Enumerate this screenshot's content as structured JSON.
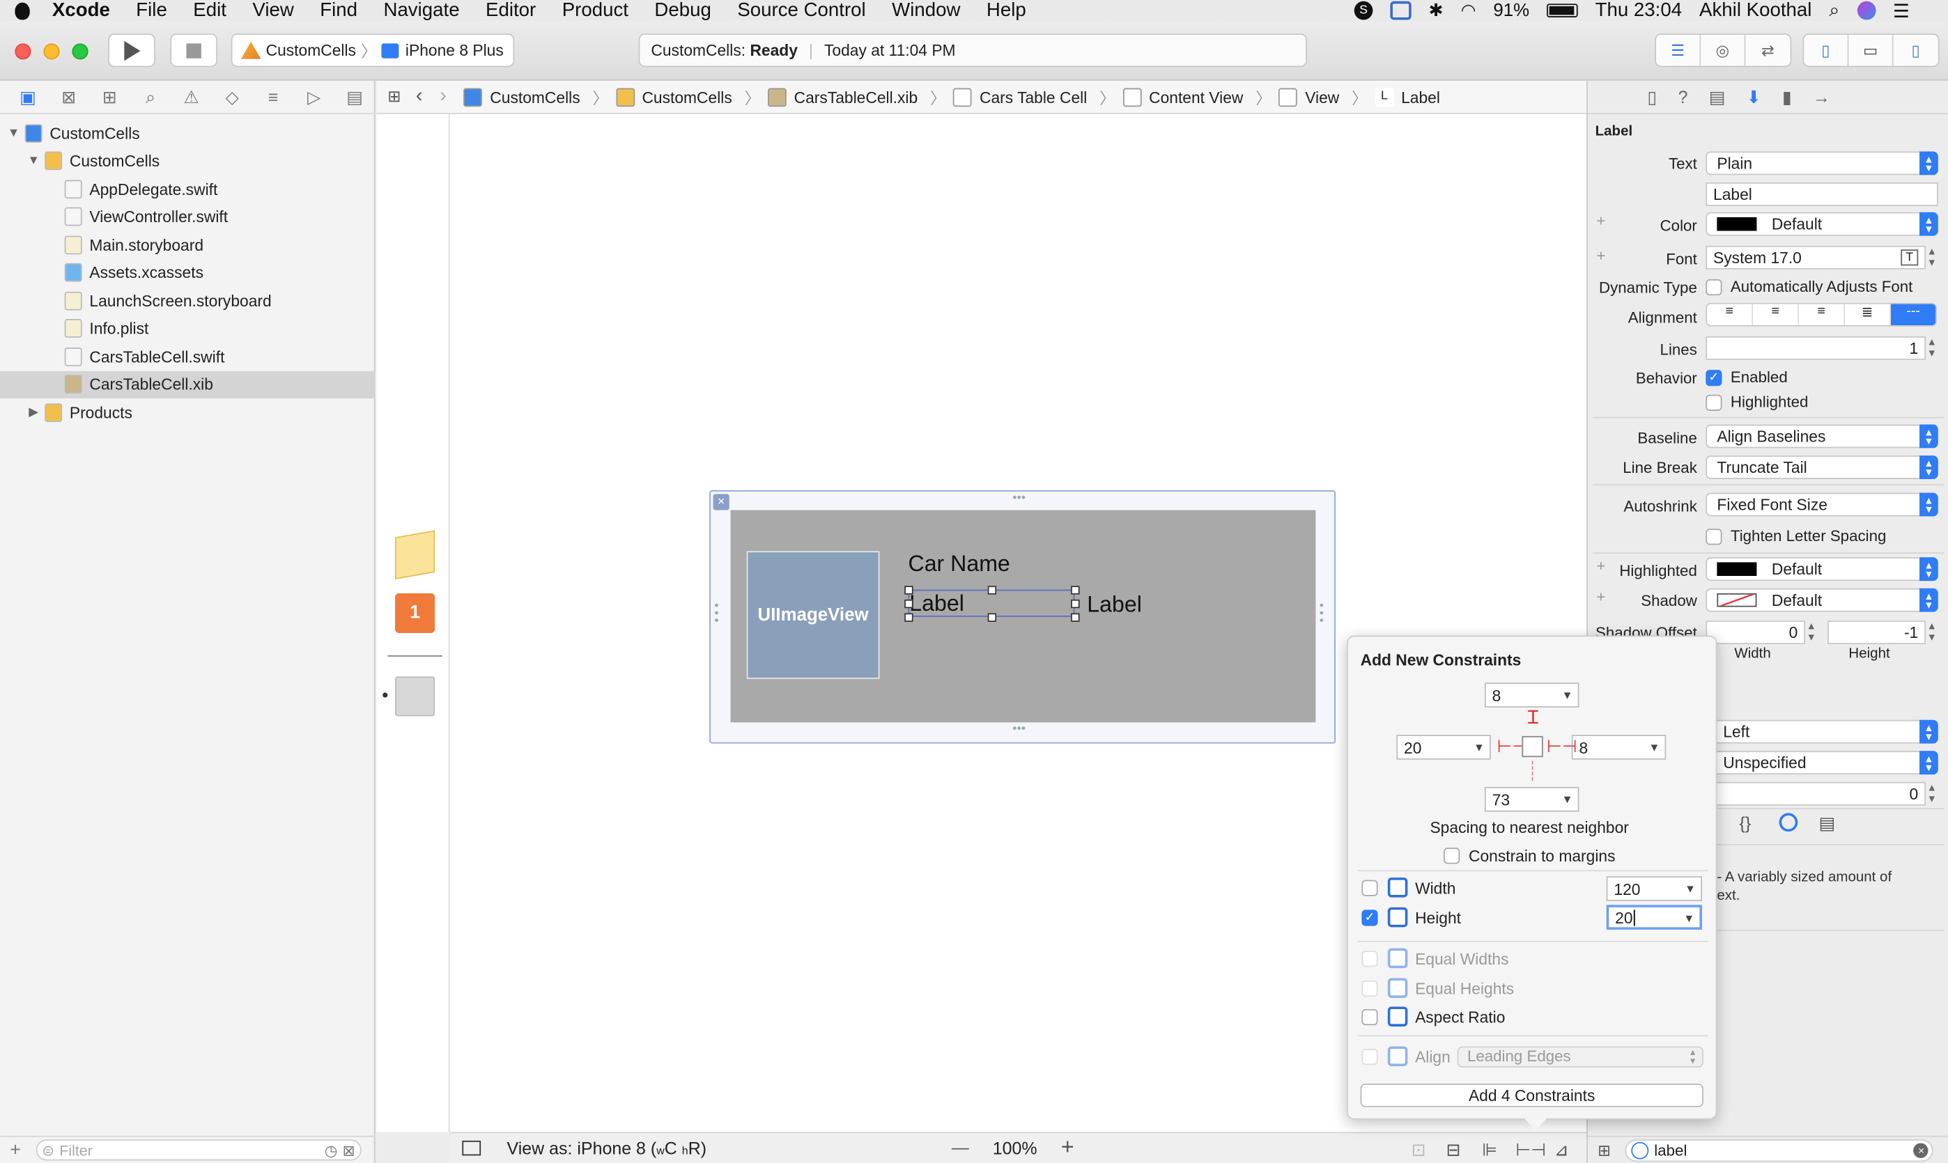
{
  "menubar": {
    "apple": "",
    "app": "Xcode",
    "items": [
      "File",
      "Edit",
      "View",
      "Find",
      "Navigate",
      "Editor",
      "Product",
      "Debug",
      "Source Control",
      "Window",
      "Help"
    ],
    "battery": "91%",
    "clock": "Thu 23:04",
    "user": "Akhil Koothal"
  },
  "toolbar": {
    "scheme": "CustomCells",
    "device": "iPhone 8 Plus",
    "status_project": "CustomCells:",
    "status_state": "Ready",
    "status_time": "Today at 11:04 PM"
  },
  "navigator": {
    "items": [
      {
        "label": "CustomCells",
        "indent": 0,
        "disc": "▼",
        "icon": "project-icon"
      },
      {
        "label": "CustomCells",
        "indent": 1,
        "disc": "▼",
        "icon": "folder-icon"
      },
      {
        "label": "AppDelegate.swift",
        "indent": 2,
        "disc": "",
        "icon": "swift-file-icon"
      },
      {
        "label": "ViewController.swift",
        "indent": 2,
        "disc": "",
        "icon": "swift-file-icon"
      },
      {
        "label": "Main.storyboard",
        "indent": 2,
        "disc": "",
        "icon": "storyboard-file-icon"
      },
      {
        "label": "Assets.xcassets",
        "indent": 2,
        "disc": "",
        "icon": "assets-folder-icon"
      },
      {
        "label": "LaunchScreen.storyboard",
        "indent": 2,
        "disc": "",
        "icon": "storyboard-file-icon"
      },
      {
        "label": "Info.plist",
        "indent": 2,
        "disc": "",
        "icon": "plist-file-icon"
      },
      {
        "label": "CarsTableCell.swift",
        "indent": 2,
        "disc": "",
        "icon": "swift-file-icon"
      },
      {
        "label": "CarsTableCell.xib",
        "indent": 2,
        "disc": "",
        "icon": "xib-file-icon",
        "selected": true
      },
      {
        "label": "Products",
        "indent": 1,
        "disc": "▶",
        "icon": "folder-icon"
      }
    ],
    "filter_placeholder": "Filter"
  },
  "jumpbar": {
    "crumbs": [
      "CustomCells",
      "CustomCells",
      "CarsTableCell.xib",
      "Cars Table Cell",
      "Content View",
      "View",
      "Label"
    ]
  },
  "canvas": {
    "image_view": "UIImageView",
    "car_name": "Car Name",
    "label_selected": "Label",
    "label_right": "Label"
  },
  "bottombar": {
    "view_as": "View as: iPhone 8 (",
    "size_w": "w",
    "size_c": "C ",
    "size_h": "h",
    "size_r": "R)",
    "zoom": "100%",
    "zoom_out": "—",
    "zoom_in": "+"
  },
  "inspector": {
    "title": "Label",
    "text_label": "Text",
    "text_type": "Plain",
    "text_value": "Label",
    "color_label": "Color",
    "color_value": "Default",
    "font_label": "Font",
    "font_value": "System 17.0",
    "dynamic_type_label": "Dynamic Type",
    "dynamic_type_value": "Automatically Adjusts Font",
    "alignment_label": "Alignment",
    "lines_label": "Lines",
    "lines_value": "1",
    "behavior_label": "Behavior",
    "enabled": "Enabled",
    "highlighted": "Highlighted",
    "baseline_label": "Baseline",
    "baseline_value": "Align Baselines",
    "linebreak_label": "Line Break",
    "linebreak_value": "Truncate Tail",
    "autoshrink_label": "Autoshrink",
    "autoshrink_value": "Fixed Font Size",
    "tighten": "Tighten Letter Spacing",
    "highlighted_label": "Highlighted",
    "highlighted_value": "Default",
    "shadow_label": "Shadow",
    "shadow_value": "Default",
    "shadow_offset_label": "Shadow Offset",
    "shadow_w": "0",
    "shadow_h": "-1",
    "width_caption": "Width",
    "height_caption": "Height",
    "left_value": "Left",
    "unspecified_value": "Unspecified",
    "zero_value": "0",
    "desc_line1": "- A variably sized amount of",
    "desc_line2": "ext.",
    "search_value": "label"
  },
  "popover": {
    "title": "Add New Constraints",
    "top": "8",
    "left": "20",
    "right": "8",
    "bottom": "73",
    "spacing": "Spacing to nearest neighbor",
    "margins": "Constrain to margins",
    "width_label": "Width",
    "width_value": "120",
    "height_label": "Height",
    "height_value": "20",
    "equal_widths": "Equal Widths",
    "equal_heights": "Equal Heights",
    "aspect": "Aspect Ratio",
    "align_label": "Align",
    "align_value": "Leading Edges",
    "add_button": "Add 4 Constraints"
  },
  "colors": {
    "accent": "#2f7cf6",
    "cell_bg": "#a9a9a9",
    "imageview_bg": "#8aa0ba",
    "selection": "#5a6fc0"
  }
}
